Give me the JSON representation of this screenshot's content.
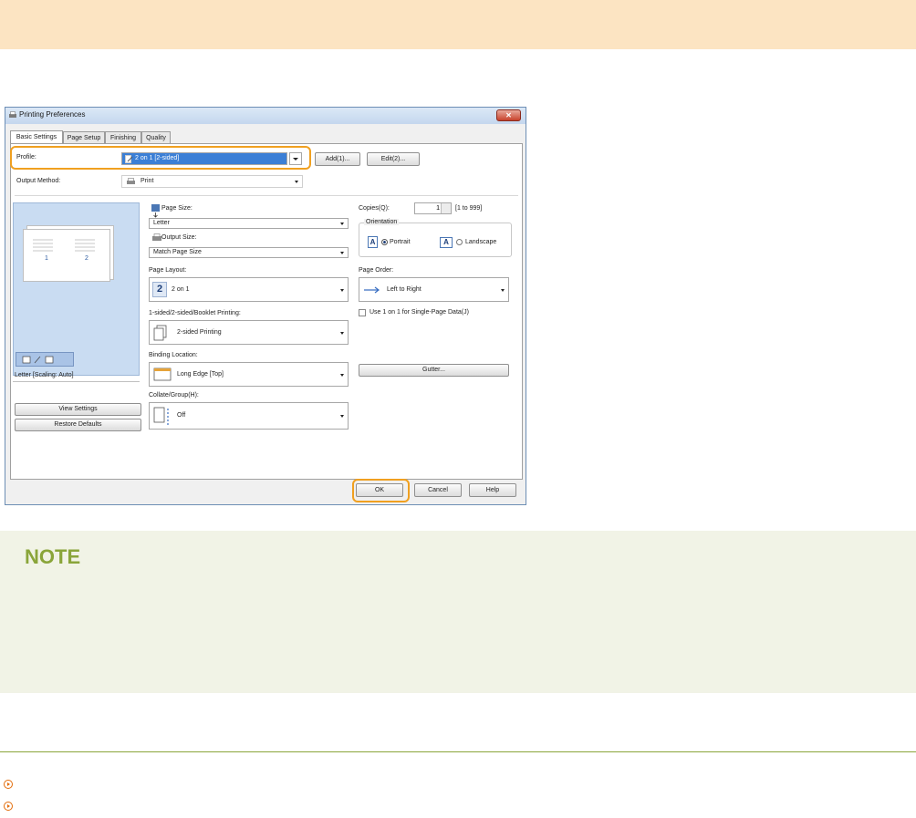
{
  "dialog": {
    "title": "Printing Preferences",
    "close_label": "✕",
    "tabs": [
      "Basic Settings",
      "Page Setup",
      "Finishing",
      "Quality"
    ],
    "profile": {
      "label": "Profile:",
      "value": "2 on 1 [2-sided]",
      "add_label": "Add(1)...",
      "edit_label": "Edit(2)..."
    },
    "output_method": {
      "label": "Output Method:",
      "value": "Print"
    },
    "preview": {
      "caption": "Letter [Scaling: Auto]",
      "page_numbers": [
        "1",
        "2"
      ],
      "view_settings_label": "View Settings",
      "restore_defaults_label": "Restore Defaults"
    },
    "page_size": {
      "label": "Page Size:",
      "value": "Letter"
    },
    "output_size": {
      "label": "Output Size:",
      "value": "Match Page Size"
    },
    "page_layout": {
      "label": "Page Layout:",
      "value": "2 on 1",
      "icon_text": "2"
    },
    "sided": {
      "label": "1-sided/2-sided/Booklet Printing:",
      "value": "2-sided Printing"
    },
    "binding": {
      "label": "Binding Location:",
      "value": "Long Edge [Top]"
    },
    "collate": {
      "label": "Collate/Group(H):",
      "value": "Off"
    },
    "copies": {
      "label": "Copies(Q):",
      "value": "1",
      "range": "[1 to 999]"
    },
    "orientation": {
      "label": "Orientation",
      "portrait": "Portrait",
      "landscape": "Landscape",
      "icon_letter": "A"
    },
    "page_order": {
      "label": "Page Order:",
      "value": "Left to Right"
    },
    "single_page": {
      "label": "Use 1 on 1 for Single-Page Data(J)"
    },
    "gutter_label": "Gutter...",
    "buttons": {
      "ok": "OK",
      "cancel": "Cancel",
      "help": "Help"
    }
  },
  "note": {
    "title": "NOTE"
  },
  "colors": {
    "accent": "#f0a020",
    "note_green": "#8aa53a",
    "banner": "#fce4c2",
    "link_orange": "#e36c0a"
  }
}
